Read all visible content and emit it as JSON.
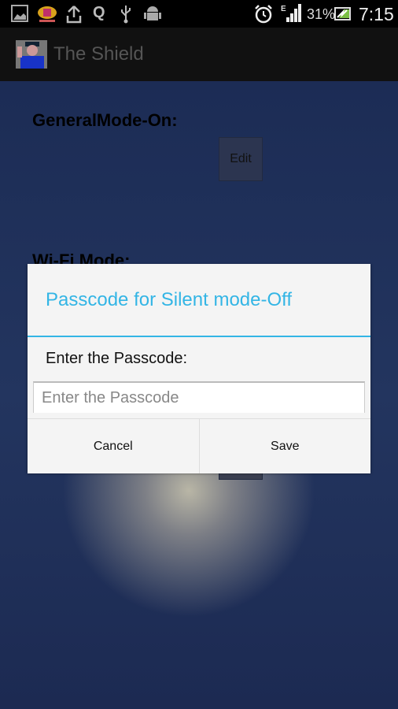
{
  "status_bar": {
    "icons_left": [
      "gallery-icon",
      "mynoted-app-icon",
      "upload-icon",
      "q-app-icon",
      "usb-icon",
      "android-debug-icon"
    ],
    "icons_right": [
      "alarm-icon",
      "signal-edge-icon",
      "battery-charging-icon"
    ],
    "network_type": "E",
    "battery_percent": "31%",
    "time": "7:15"
  },
  "app_bar": {
    "title": "The Shield",
    "logo": "police-officer-logo"
  },
  "content": {
    "general_mode_label": "GeneralMode-On:",
    "edit_label": "Edit",
    "wifi_mode_label": "Wi-Fi Mode:"
  },
  "dialog": {
    "title": "Passcode for Silent mode-Off",
    "message": "Enter the Passcode:",
    "input_placeholder": "Enter the Passcode",
    "input_value": "",
    "cancel_label": "Cancel",
    "save_label": "Save",
    "accent_color": "#33b5e5"
  }
}
